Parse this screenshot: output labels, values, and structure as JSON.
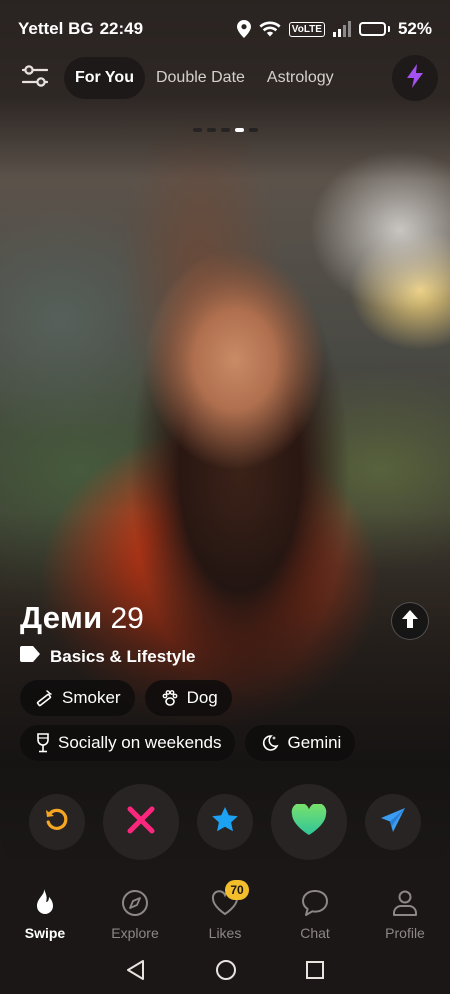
{
  "status_bar": {
    "carrier": "Yettel BG",
    "time": "22:49",
    "network_badge": "VoLTE",
    "battery_percent": "52%",
    "battery_level": 0.52,
    "icons": [
      "location-icon",
      "wifi-icon",
      "signal-icon",
      "battery-icon"
    ]
  },
  "top_nav": {
    "filter_icon": "sliders-icon",
    "tabs": [
      {
        "label": "For You",
        "active": true
      },
      {
        "label": "Double Date",
        "active": false
      },
      {
        "label": "Astrology",
        "active": false
      }
    ],
    "boost_icon": "lightning-icon"
  },
  "photo_indicator": {
    "count": 5,
    "current": 4
  },
  "profile": {
    "name": "Деми",
    "age": "29",
    "section_label": "Basics & Lifestyle",
    "section_icon": "tag-icon",
    "chips_row1": [
      {
        "label": "Smoker",
        "icon": "smoking-icon"
      },
      {
        "label": "Dog",
        "icon": "paw-icon"
      }
    ],
    "chips_row2": [
      {
        "label": "Socially on weekends",
        "icon": "drink-glass-icon"
      },
      {
        "label": "Gemini",
        "icon": "moon-icon"
      }
    ],
    "expand_icon": "arrow-up-icon"
  },
  "actions": [
    {
      "name": "rewind",
      "icon": "rewind-icon",
      "color": "#f5a623"
    },
    {
      "name": "nope",
      "icon": "x-icon",
      "color": "#fd267d"
    },
    {
      "name": "super-like",
      "icon": "star-icon",
      "color": "#1da1f2"
    },
    {
      "name": "like",
      "icon": "heart-icon",
      "color": "#3ddc84"
    },
    {
      "name": "send",
      "icon": "paper-plane-icon",
      "color": "#3a9df2"
    }
  ],
  "bottom_nav": [
    {
      "label": "Swipe",
      "icon": "flame-icon",
      "active": true
    },
    {
      "label": "Explore",
      "icon": "compass-icon",
      "active": false
    },
    {
      "label": "Likes",
      "icon": "heart-outline-icon",
      "active": false,
      "badge": "70"
    },
    {
      "label": "Chat",
      "icon": "chat-bubble-icon",
      "active": false
    },
    {
      "label": "Profile",
      "icon": "person-icon",
      "active": false
    }
  ],
  "system_nav": [
    "back-icon",
    "home-icon",
    "recents-icon"
  ],
  "colors": {
    "background": "#1b1717",
    "chip_bg": "#0f0d0d",
    "badge": "#f2be2b",
    "boost": "#a550f0"
  }
}
